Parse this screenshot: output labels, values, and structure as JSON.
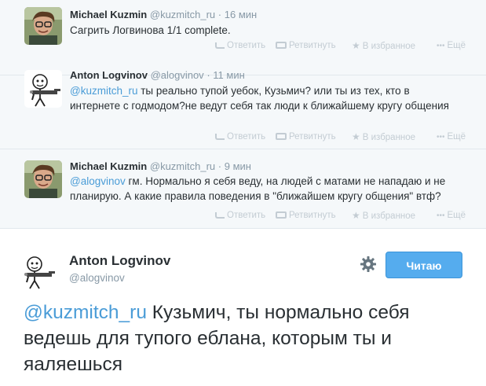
{
  "colors": {
    "link": "#4a9cd7",
    "follow_button": "#55acee",
    "thread_bg": "#f5f8fa"
  },
  "thread": [
    {
      "fullname": "Michael Kuzmin",
      "handle": "@kuzmitch_ru",
      "dot": "·",
      "time": "16 мин",
      "mention": "",
      "text": "Сагрить Логвинова 1/1 complete.",
      "avatar_icon": "michael-avatar",
      "actions": {
        "reply": "Ответить",
        "retweet": "Ретвитнуть",
        "favorite": "В избранное",
        "more": "Ещё"
      }
    },
    {
      "fullname": "Anton Logvinov",
      "handle": "@alogvinov",
      "dot": "·",
      "time": "11 мин",
      "mention": "@kuzmitch_ru",
      "text": " ты реально тупой уебок, Кузьмич? или ты из тех, кто в интернете с годмодом?не ведут себя так люди к ближайшему кругу общения",
      "avatar_icon": "anton-avatar",
      "actions": {
        "reply": "Ответить",
        "retweet": "Ретвитнуть",
        "favorite": "В избранное",
        "more": "Ещё"
      }
    },
    {
      "fullname": "Michael Kuzmin",
      "handle": "@kuzmitch_ru",
      "dot": "·",
      "time": "9 мин",
      "mention": "@alogvinov",
      "text": " гм. Нормально я себя веду, на людей с матами не нападаю и не планирую. А какие правила поведения в \"ближайшем кругу общения\" втф?",
      "avatar_icon": "michael-avatar",
      "actions": {
        "reply": "Ответить",
        "retweet": "Ретвитнуть",
        "favorite": "В избранное",
        "more": "Ещё"
      }
    }
  ],
  "main": {
    "fullname": "Anton Logvinov",
    "handle": "@alogvinov",
    "follow_label": "Читаю",
    "settings_icon": "gear-icon",
    "mention": "@kuzmitch_ru",
    "text": " Кузьмич, ты нормально себя ведешь для тупого еблана, которым ты и яаляешься"
  }
}
